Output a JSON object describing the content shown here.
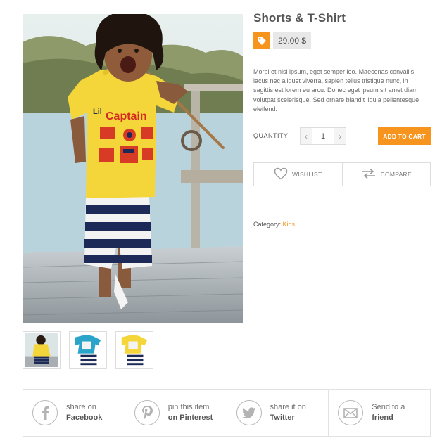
{
  "product": {
    "title": "Shorts & T-Shirt",
    "price": "29.00 $",
    "description": "Morbi et nisi ipsum, eget semper leo. Maecenas convallis, lacus nec aliquet viverra, sapien tellus tristique nunc, in sagittis est lorem eu arcu. Donec eget ipsum sit amet diam volutpat scelerisque. Sed ornare blandit ligula pellentesque eleifend.",
    "image_caption_shirt": "Captain",
    "image_caption_small": "Lil"
  },
  "thumbnails": [
    {
      "name": "yellow-shirt-kid"
    },
    {
      "name": "blue-shirt-set"
    },
    {
      "name": "yellow-shirt-set"
    }
  ],
  "quantity": {
    "label": "QUANTITY",
    "value": "1",
    "decrement": "‹",
    "increment": "›"
  },
  "add_to_cart": "ADD TO CART",
  "actions": {
    "wishlist": "WISHLIST",
    "compare": "COMPARE"
  },
  "category": {
    "label": "Category:",
    "value": "Kids",
    "suffix": "."
  },
  "share": [
    {
      "line1": "share on",
      "line2": "Facebook",
      "icon": "facebook-icon"
    },
    {
      "line1": "pin this item",
      "line2": "on Pinterest",
      "icon": "pinterest-icon"
    },
    {
      "line1": "share it on",
      "line2": "Twitter",
      "icon": "twitter-icon"
    },
    {
      "line1": "Send to a",
      "line2": "friend",
      "icon": "mail-icon"
    }
  ],
  "colors": {
    "accent": "#f7941d",
    "border": "#dddddd",
    "text": "#555555"
  }
}
